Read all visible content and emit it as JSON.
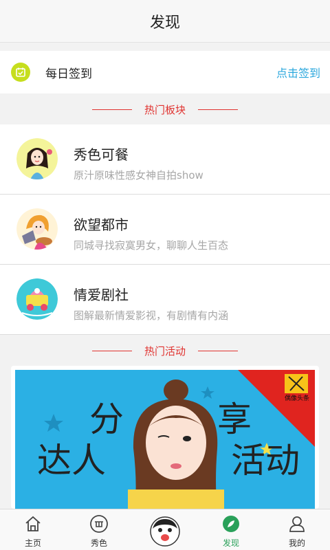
{
  "header": {
    "title": "发现"
  },
  "signin": {
    "label": "每日签到",
    "action": "点击签到"
  },
  "sections": {
    "hot_boards": "热门板块",
    "hot_events": "热门活动"
  },
  "boards": [
    {
      "title": "秀色可餐",
      "desc": "原汁原味性感女神自拍show"
    },
    {
      "title": "欲望都市",
      "desc": "同城寻找寂寞男女，聊聊人生百态"
    },
    {
      "title": "情爱剧社",
      "desc": "图解最新情爱影视，有剧情有内涵"
    }
  ],
  "banner": {
    "left_text": [
      "分",
      "达人"
    ],
    "right_text": [
      "享",
      "活动"
    ],
    "badge_text": "偶像头条"
  },
  "tabbar": {
    "items": [
      {
        "label": "主页",
        "icon": "home-icon"
      },
      {
        "label": "秀色",
        "icon": "xiuse-icon"
      },
      {
        "label": "",
        "icon": "center-avatar-icon"
      },
      {
        "label": "发现",
        "icon": "discover-icon",
        "active": true
      },
      {
        "label": "我的",
        "icon": "profile-icon"
      }
    ]
  },
  "colors": {
    "accent_red": "#e0322f",
    "link_blue": "#2aa7dd",
    "active_green": "#2aa15a",
    "calendar_yellow": "#c6de1e",
    "banner_blue": "#2bb0e4"
  }
}
